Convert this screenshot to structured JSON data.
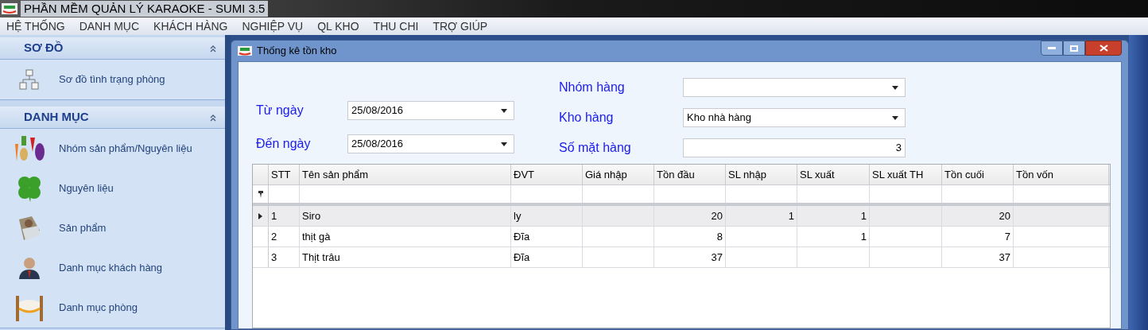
{
  "app_title": "PHẦN MỀM QUẢN LÝ KARAOKE - SUMI 3.5",
  "menu": [
    "HỆ THỐNG",
    "DANH MỤC",
    "KHÁCH HÀNG",
    "NGHIỆP VỤ",
    "QL KHO",
    "THU CHI",
    "TRỢ GIÚP"
  ],
  "sidebar": [
    {
      "title": "SƠ ĐỒ",
      "expanded": true,
      "items": [
        {
          "label": "Sơ đồ tình trạng phòng",
          "kind": "diagram"
        }
      ]
    },
    {
      "title": "DANH MỤC",
      "expanded": true,
      "items": [
        {
          "label": "Nhóm sản phẩm/Nguyên liệu",
          "kind": "vegetables"
        },
        {
          "label": "Nguyên liệu",
          "kind": "clover"
        },
        {
          "label": "Sản phẩm",
          "kind": "product"
        },
        {
          "label": "Danh mục khách hàng",
          "kind": "person"
        },
        {
          "label": "Danh mục phòng",
          "kind": "room"
        }
      ]
    }
  ],
  "dialog": {
    "title": "Thống kê tồn kho",
    "left_fields": [
      {
        "label": "Từ ngày",
        "value": "25/08/2016",
        "kind": "dropdown"
      },
      {
        "label": "Đến ngày",
        "value": "25/08/2016",
        "kind": "dropdown"
      }
    ],
    "right_fields": [
      {
        "label": "Nhóm hàng",
        "kind": "dropdown"
      },
      {
        "label": "Kho hàng",
        "value": "Kho nhà hàng",
        "kind": "dropdown"
      },
      {
        "label": "Số mặt hàng",
        "value": "3",
        "kind": "number"
      }
    ],
    "table": {
      "columns": [
        "STT",
        "Tên sản phẩm",
        "ĐVT",
        "Giá nhập",
        "Tồn đầu",
        "SL nhập",
        "SL xuất",
        "SL xuất TH",
        "Tồn cuối",
        "Tồn vốn"
      ],
      "rows": [
        {
          "selected": true,
          "cells": [
            "1",
            "Siro",
            "ly",
            "",
            "20",
            "1",
            "1",
            "",
            "20",
            ""
          ]
        },
        {
          "selected": false,
          "cells": [
            "2",
            "thịt gà",
            "Đĩa",
            "",
            "8",
            "",
            "1",
            "",
            "7",
            ""
          ]
        },
        {
          "selected": false,
          "cells": [
            "3",
            "Thịt trâu",
            "Đĩa",
            "",
            "37",
            "",
            "",
            "",
            "37",
            ""
          ]
        }
      ]
    }
  }
}
